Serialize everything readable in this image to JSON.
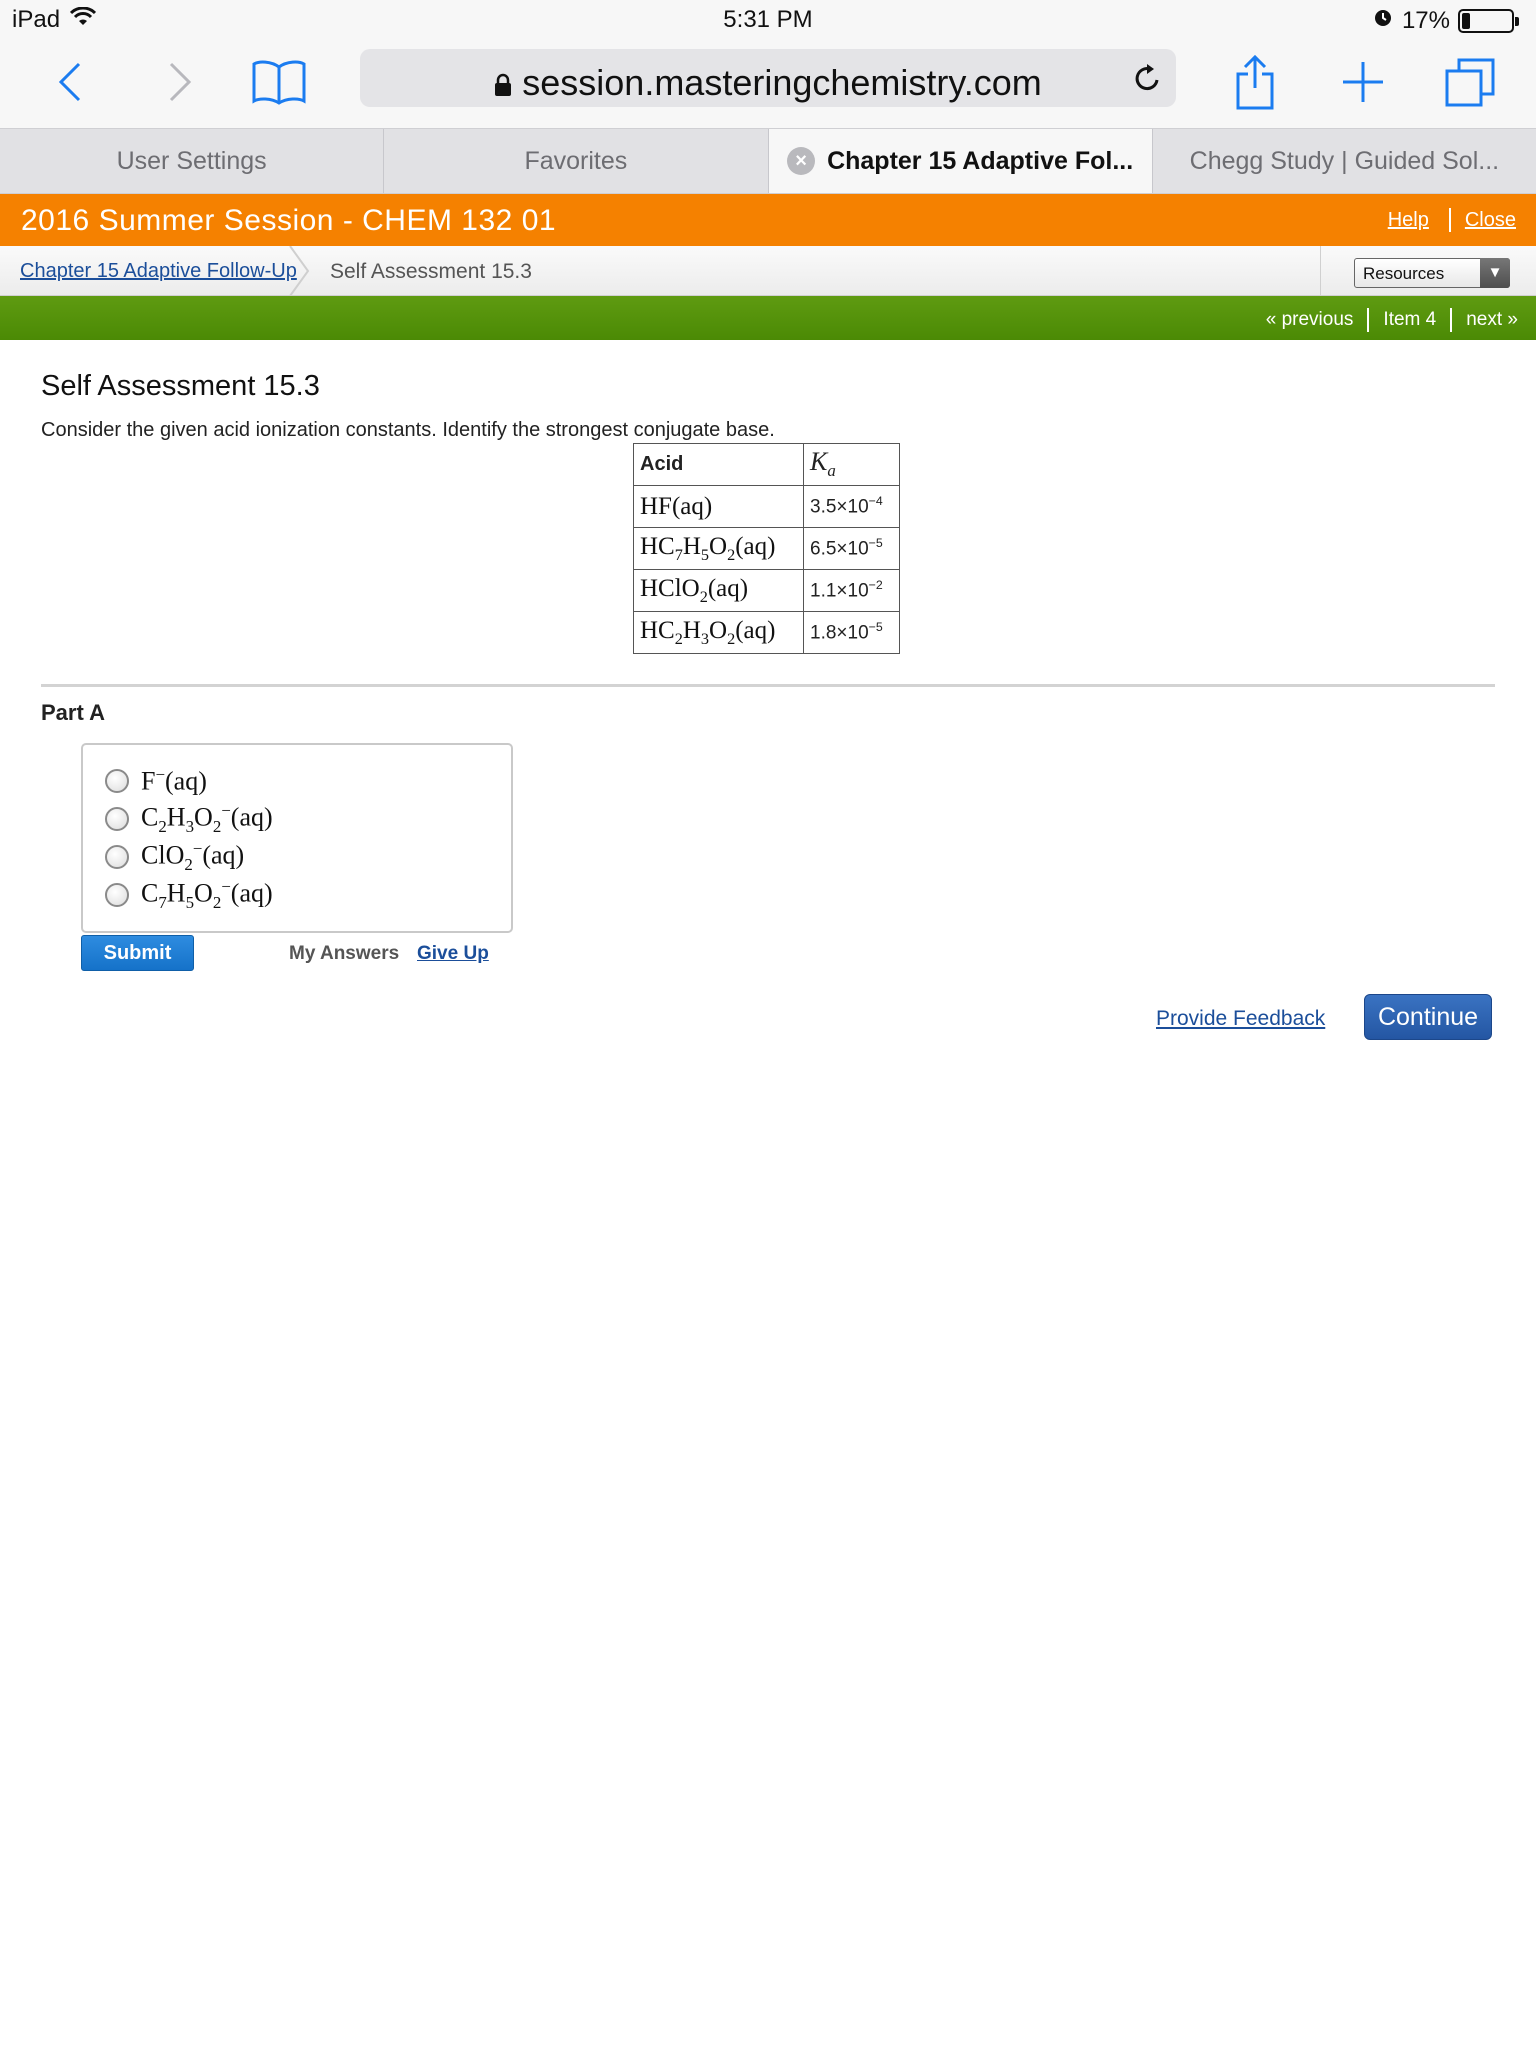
{
  "status_bar": {
    "device": "iPad",
    "time": "5:31 PM",
    "battery_percent": "17%",
    "battery_level": 0.17
  },
  "browser": {
    "url": "session.masteringchemistry.com",
    "tabs": [
      {
        "label": "User Settings",
        "active": false
      },
      {
        "label": "Favorites",
        "active": false
      },
      {
        "label": "Chapter 15 Adaptive Fol...",
        "active": true
      },
      {
        "label": "Chegg Study | Guided Sol...",
        "active": false
      }
    ]
  },
  "course": {
    "title": "2016 Summer Session - CHEM 132 01",
    "help": "Help",
    "close": "Close",
    "color": "#f58100"
  },
  "breadcrumb": {
    "parent": "Chapter 15 Adaptive Follow-Up",
    "current": "Self Assessment 15.3"
  },
  "resources": {
    "label": "Resources"
  },
  "nav": {
    "previous": "« previous",
    "item": "Item 4",
    "next": "next »"
  },
  "content": {
    "title": "Self Assessment 15.3",
    "question": "Consider the given acid ionization constants. Identify the strongest conjugate base.",
    "table": {
      "header_acid": "Acid",
      "header_ka": "Ka",
      "rows": [
        {
          "acid": "HF(aq)",
          "ka": "3.5×10−4"
        },
        {
          "acid": "HC7H5O2(aq)",
          "ka": "6.5×10−5"
        },
        {
          "acid": "HClO2(aq)",
          "ka": "1.1×10−2"
        },
        {
          "acid": "HC2H3O2(aq)",
          "ka": "1.8×10−5"
        }
      ]
    },
    "part_label": "Part A",
    "choices": [
      "F−(aq)",
      "C2H3O2−(aq)",
      "ClO2−(aq)",
      "C7H5O2−(aq)"
    ],
    "submit": "Submit",
    "my_answers": "My Answers",
    "give_up": "Give Up",
    "provide_feedback": "Provide Feedback",
    "continue": "Continue"
  }
}
